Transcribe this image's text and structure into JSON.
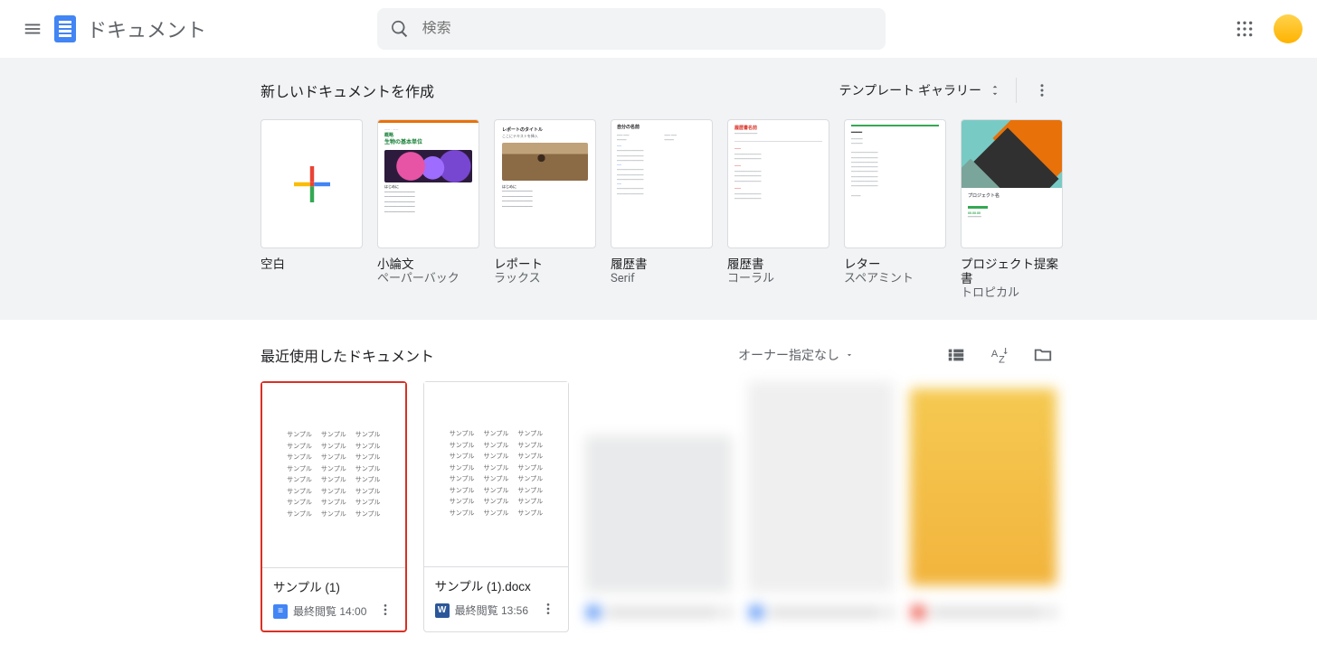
{
  "header": {
    "app_name": "ドキュメント",
    "search_placeholder": "検索"
  },
  "templates": {
    "section_title": "新しいドキュメントを作成",
    "gallery_label": "テンプレート ギャラリー",
    "items": [
      {
        "title": "空白",
        "sub": ""
      },
      {
        "title": "小論文",
        "sub": "ペーパーバック"
      },
      {
        "title": "レポート",
        "sub": "ラックス"
      },
      {
        "title": "履歴書",
        "sub": "Serif"
      },
      {
        "title": "履歴書",
        "sub": "コーラル"
      },
      {
        "title": "レター",
        "sub": "スペアミント"
      },
      {
        "title": "プロジェクト提案書",
        "sub": "トロピカル"
      }
    ],
    "preview": {
      "lux_t1": "概略",
      "lux_t2": "生物の基本単位",
      "lux_h": "はじめに",
      "rep_t": "レポートのタイトル",
      "rep_s": "ここにテキストを挿入",
      "rep_h": "はじめに",
      "serif_name": "自分の名前",
      "coral_name": "履歴書名前",
      "trop_name": "プロジェクト名"
    }
  },
  "recent": {
    "section_title": "最近使用したドキュメント",
    "owner_filter": "オーナー指定なし",
    "docs": [
      {
        "name": "サンプル (1)",
        "time": "最終閲覧 14:00",
        "badge": "docs",
        "selected": true
      },
      {
        "name": "サンプル (1).docx",
        "time": "最終閲覧 13:56",
        "badge": "word",
        "selected": false
      }
    ],
    "sample_word": "サンプル"
  }
}
